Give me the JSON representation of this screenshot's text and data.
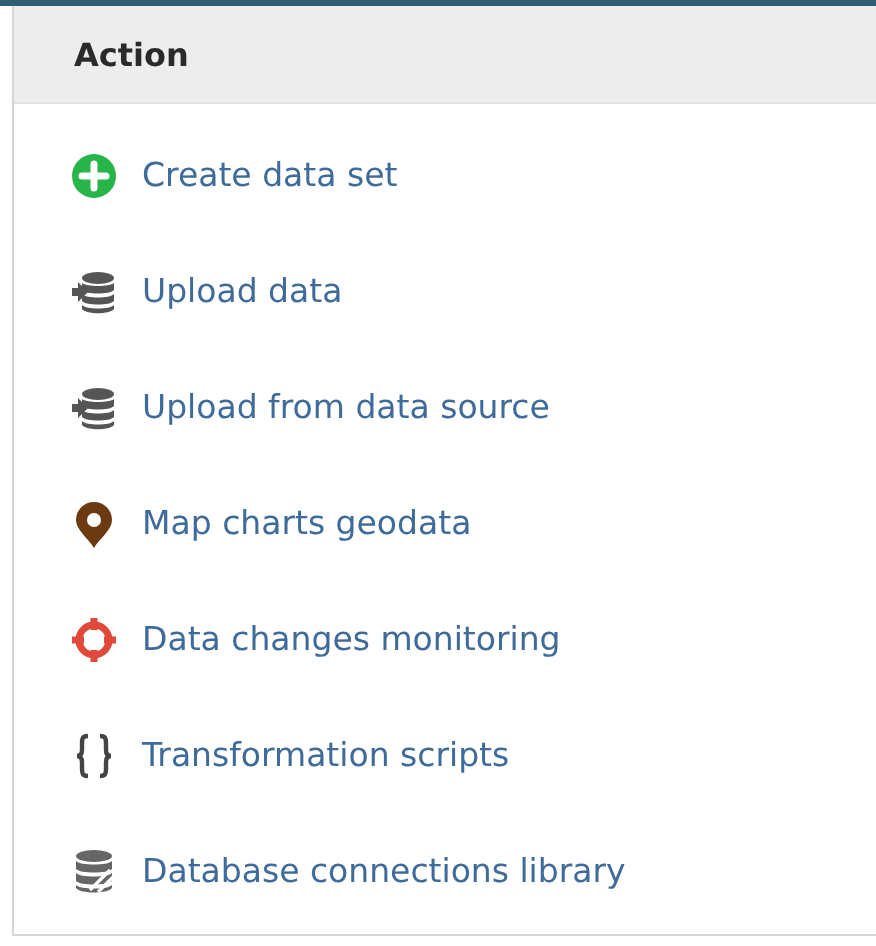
{
  "panel": {
    "title": "Action",
    "items": [
      {
        "kind": "create",
        "label": "Create data set"
      },
      {
        "kind": "upload",
        "label": "Upload data"
      },
      {
        "kind": "upload",
        "label": "Upload from data source"
      },
      {
        "kind": "pin",
        "label": "Map charts geodata"
      },
      {
        "kind": "monitor",
        "label": "Data changes monitoring"
      },
      {
        "kind": "script",
        "label": "Transformation scripts"
      },
      {
        "kind": "library",
        "label": "Database connections library"
      }
    ]
  }
}
